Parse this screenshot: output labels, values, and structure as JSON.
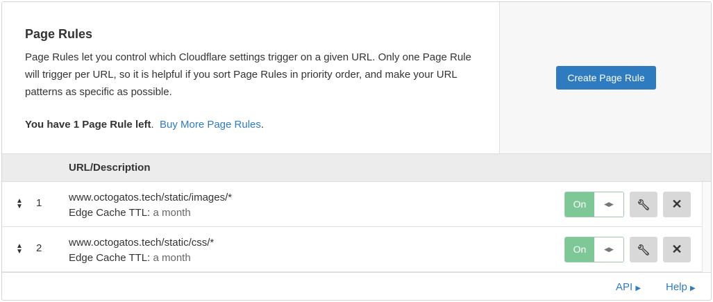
{
  "intro": {
    "title": "Page Rules",
    "description": "Page Rules let you control which Cloudflare settings trigger on a given URL. Only one Page Rule will trigger per URL, so it is helpful if you sort Page Rules in priority order, and make your URL patterns as specific as possible.",
    "remaining": "You have 1 Page Rule left",
    "period": ".",
    "buy_link": "Buy More Page Rules",
    "buy_period": "."
  },
  "side": {
    "create_label": "Create Page Rule"
  },
  "table": {
    "header": "URL/Description",
    "rows": [
      {
        "num": "1",
        "url": "www.octogatos.tech/static/images/*",
        "setting": "Edge Cache TTL:",
        "value": "a month",
        "status": "On"
      },
      {
        "num": "2",
        "url": "www.octogatos.tech/static/css/*",
        "setting": "Edge Cache TTL:",
        "value": "a month",
        "status": "On"
      }
    ]
  },
  "footer": {
    "api": "API",
    "help": "Help"
  },
  "colors": {
    "accent": "#2f7bbf",
    "on": "#7ec796"
  },
  "icons": {
    "sort": "sort-icon",
    "edit": "wrench-icon",
    "delete": "close-icon",
    "drag": "arrows-horizontal-icon",
    "link": "caret-right-icon"
  }
}
